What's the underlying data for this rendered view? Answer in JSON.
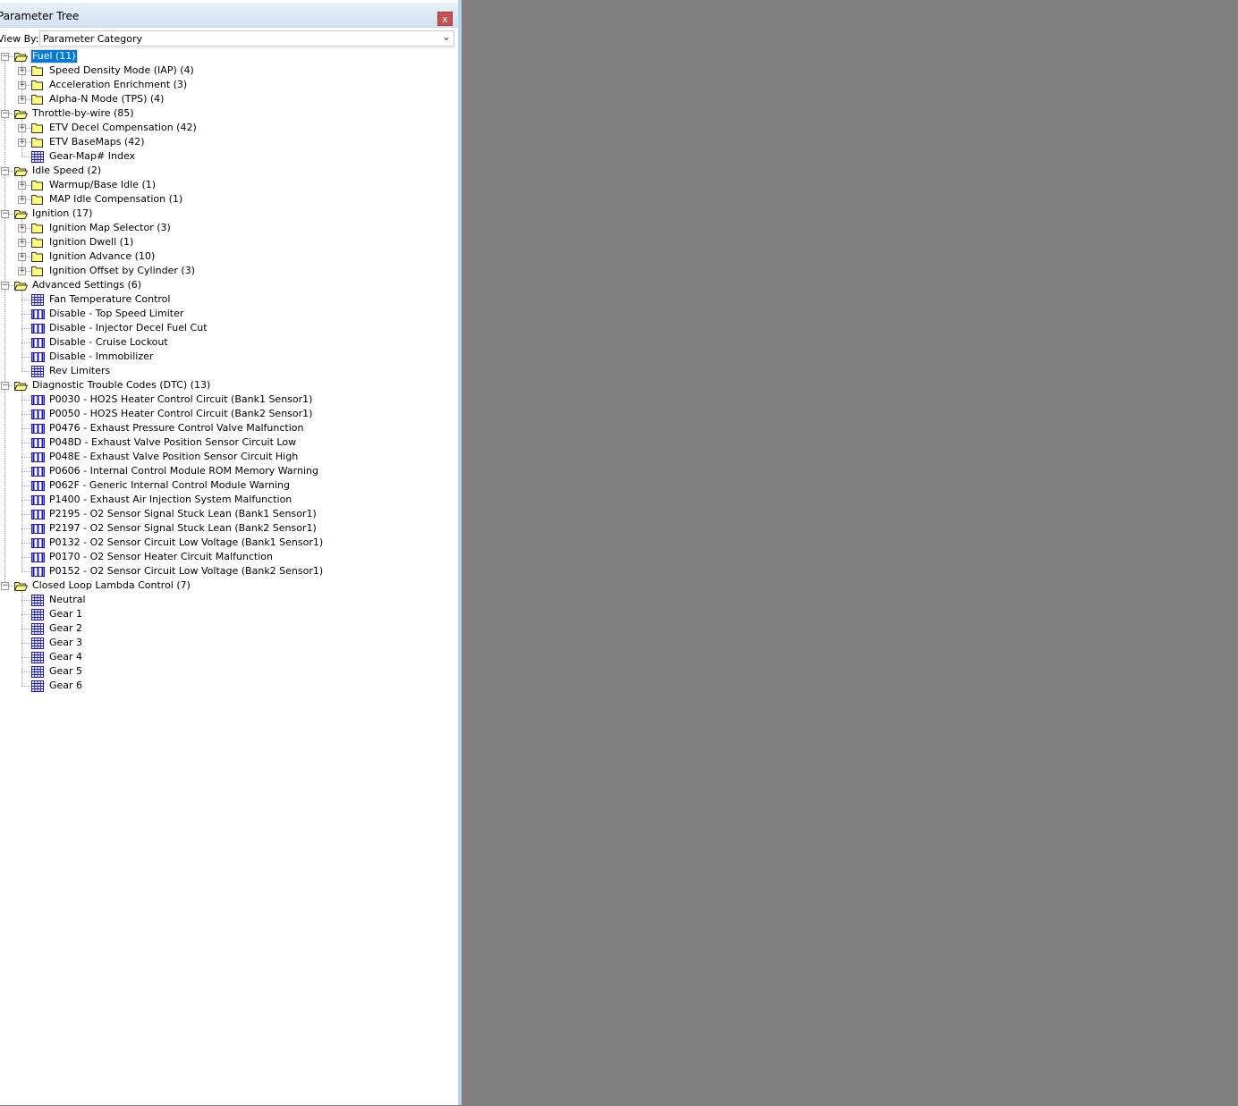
{
  "panel": {
    "title": "Parameter Tree",
    "close_label": "x",
    "view_by_label": "View By:",
    "view_by_value": "Parameter Category"
  },
  "tree": [
    {
      "label": "Fuel (11)",
      "depth": 0,
      "kind": "open-folder",
      "expander": "minus",
      "selected": true
    },
    {
      "label": "Speed Density Mode (IAP) (4)",
      "depth": 1,
      "kind": "folder",
      "expander": "plus"
    },
    {
      "label": "Acceleration Enrichment (3)",
      "depth": 1,
      "kind": "folder",
      "expander": "plus"
    },
    {
      "label": "Alpha-N Mode (TPS) (4)",
      "depth": 1,
      "kind": "folder",
      "expander": "plus"
    },
    {
      "label": "Throttle-by-wire (85)",
      "depth": 0,
      "kind": "open-folder",
      "expander": "minus"
    },
    {
      "label": "ETV Decel Compensation (42)",
      "depth": 1,
      "kind": "folder",
      "expander": "plus"
    },
    {
      "label": "ETV BaseMaps (42)",
      "depth": 1,
      "kind": "folder",
      "expander": "plus"
    },
    {
      "label": "Gear-Map# Index",
      "depth": 1,
      "kind": "table"
    },
    {
      "label": "Idle Speed (2)",
      "depth": 0,
      "kind": "open-folder",
      "expander": "minus"
    },
    {
      "label": "Warmup/Base Idle (1)",
      "depth": 1,
      "kind": "folder",
      "expander": "plus"
    },
    {
      "label": "MAP Idle Compensation (1)",
      "depth": 1,
      "kind": "folder",
      "expander": "plus"
    },
    {
      "label": "Ignition (17)",
      "depth": 0,
      "kind": "open-folder",
      "expander": "minus"
    },
    {
      "label": "Ignition Map Selector (3)",
      "depth": 1,
      "kind": "folder",
      "expander": "plus"
    },
    {
      "label": "Ignition Dwell (1)",
      "depth": 1,
      "kind": "folder",
      "expander": "plus"
    },
    {
      "label": "Ignition Advance (10)",
      "depth": 1,
      "kind": "folder",
      "expander": "plus"
    },
    {
      "label": "Ignition Offset by Cylinder (3)",
      "depth": 1,
      "kind": "folder",
      "expander": "plus"
    },
    {
      "label": "Advanced Settings (6)",
      "depth": 0,
      "kind": "open-folder",
      "expander": "minus"
    },
    {
      "label": "Fan Temperature Control",
      "depth": 1,
      "kind": "table"
    },
    {
      "label": "Disable - Top Speed Limiter",
      "depth": 1,
      "kind": "switch"
    },
    {
      "label": "Disable - Injector Decel Fuel Cut",
      "depth": 1,
      "kind": "switch"
    },
    {
      "label": "Disable - Cruise Lockout",
      "depth": 1,
      "kind": "switch"
    },
    {
      "label": "Disable - Immobilizer",
      "depth": 1,
      "kind": "switch"
    },
    {
      "label": "Rev Limiters",
      "depth": 1,
      "kind": "table"
    },
    {
      "label": "Diagnostic Trouble Codes (DTC) (13)",
      "depth": 0,
      "kind": "open-folder",
      "expander": "minus"
    },
    {
      "label": "P0030 - HO2S Heater Control Circuit (Bank1 Sensor1)",
      "depth": 1,
      "kind": "switch"
    },
    {
      "label": "P0050 - HO2S Heater Control Circuit (Bank2 Sensor1)",
      "depth": 1,
      "kind": "switch"
    },
    {
      "label": "P0476 - Exhaust Pressure Control Valve Malfunction",
      "depth": 1,
      "kind": "switch"
    },
    {
      "label": "P048D - Exhaust Valve Position Sensor Circuit Low",
      "depth": 1,
      "kind": "switch"
    },
    {
      "label": "P048E - Exhaust Valve Position Sensor Circuit High",
      "depth": 1,
      "kind": "switch"
    },
    {
      "label": "P0606 - Internal Control Module ROM Memory Warning",
      "depth": 1,
      "kind": "switch"
    },
    {
      "label": "P062F - Generic Internal Control Module Warning",
      "depth": 1,
      "kind": "switch"
    },
    {
      "label": "P1400 - Exhaust Air Injection System Malfunction",
      "depth": 1,
      "kind": "switch"
    },
    {
      "label": "P2195 - O2 Sensor Signal Stuck Lean (Bank1 Sensor1)",
      "depth": 1,
      "kind": "switch"
    },
    {
      "label": "P2197 - O2 Sensor Signal Stuck Lean (Bank2 Sensor1)",
      "depth": 1,
      "kind": "switch"
    },
    {
      "label": "P0132 - O2 Sensor Circuit Low Voltage (Bank1 Sensor1)",
      "depth": 1,
      "kind": "switch"
    },
    {
      "label": "P0170 - O2 Sensor Heater Circuit Malfunction",
      "depth": 1,
      "kind": "switch"
    },
    {
      "label": "P0152 - O2 Sensor Circuit Low Voltage (Bank2 Sensor1)",
      "depth": 1,
      "kind": "switch"
    },
    {
      "label": "Closed Loop Lambda Control (7)",
      "depth": 0,
      "kind": "open-folder",
      "expander": "minus"
    },
    {
      "label": "Neutral",
      "depth": 1,
      "kind": "table"
    },
    {
      "label": "Gear 1",
      "depth": 1,
      "kind": "table"
    },
    {
      "label": "Gear 2",
      "depth": 1,
      "kind": "table"
    },
    {
      "label": "Gear 3",
      "depth": 1,
      "kind": "table"
    },
    {
      "label": "Gear 4",
      "depth": 1,
      "kind": "table"
    },
    {
      "label": "Gear 5",
      "depth": 1,
      "kind": "table"
    },
    {
      "label": "Gear 6",
      "depth": 1,
      "kind": "table"
    }
  ],
  "colors": {
    "selection": "#0078d7",
    "folder": "#ffff80",
    "table_icon": "#1a1ab0",
    "workspace": "#808080"
  }
}
